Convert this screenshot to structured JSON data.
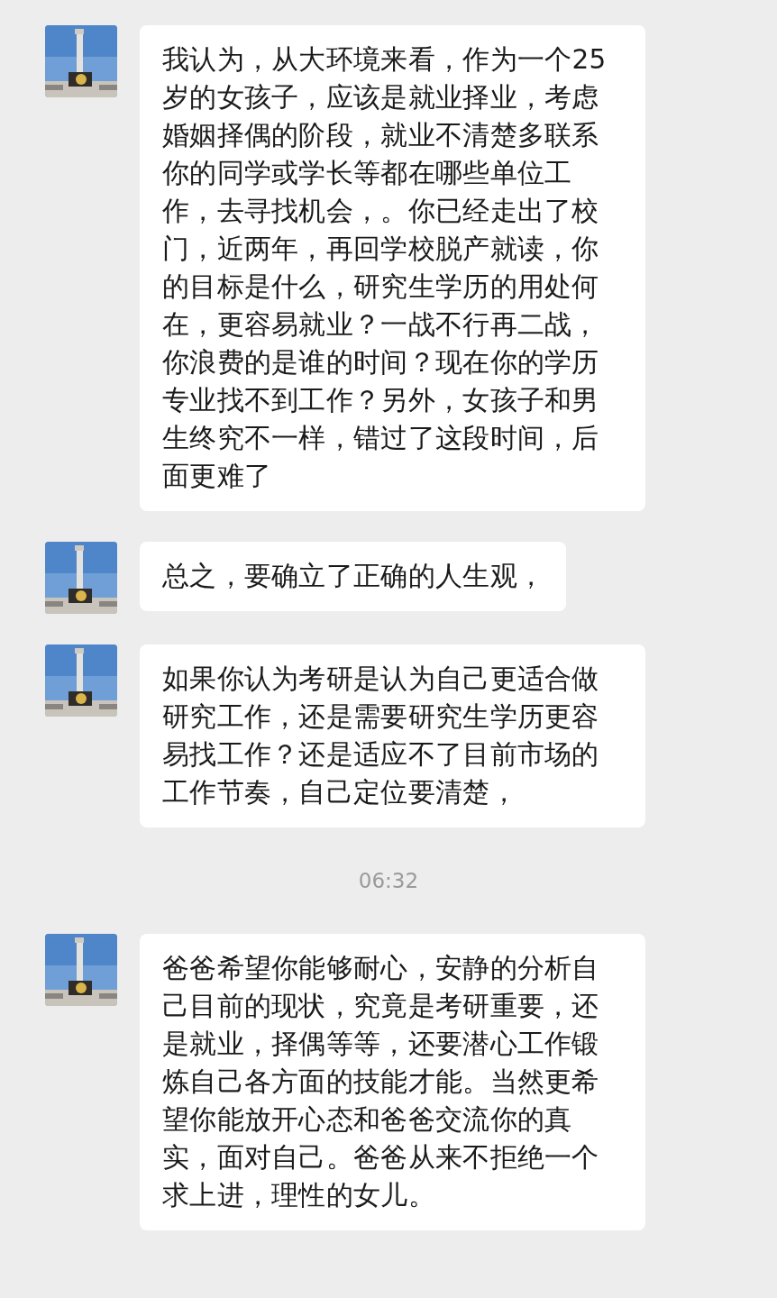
{
  "messages": [
    {
      "kind": "message",
      "text": "我认为，从大环境来看，作为一个25岁的女孩子，应该是就业择业，考虑婚姻择偶的阶段，就业不清楚多联系你的同学或学长等都在哪些单位工作，去寻找机会，。你已经走出了校门，近两年，再回学校脱产就读，你的目标是什么，研究生学历的用处何在，更容易就业？一战不行再二战，你浪费的是谁的时间？现在你的学历专业找不到工作？另外，女孩子和男生终究不一样，错过了这段时间，后面更难了"
    },
    {
      "kind": "message",
      "text": "总之，要确立了正确的人生观，"
    },
    {
      "kind": "message",
      "text": "如果你认为考研是认为自己更适合做研究工作，还是需要研究生学历更容易找工作？还是适应不了目前市场的工作节奏，自己定位要清楚，"
    },
    {
      "kind": "time",
      "text": "06:32"
    },
    {
      "kind": "message",
      "text": "爸爸希望你能够耐心，安静的分析自己目前的现状，究竟是考研重要，还是就业，择偶等等，还要潜心工作锻炼自己各方面的技能才能。当然更希望你能放开心态和爸爸交流你的真实，面对自己。爸爸从来不拒绝一个求上进，理性的女儿。"
    }
  ]
}
